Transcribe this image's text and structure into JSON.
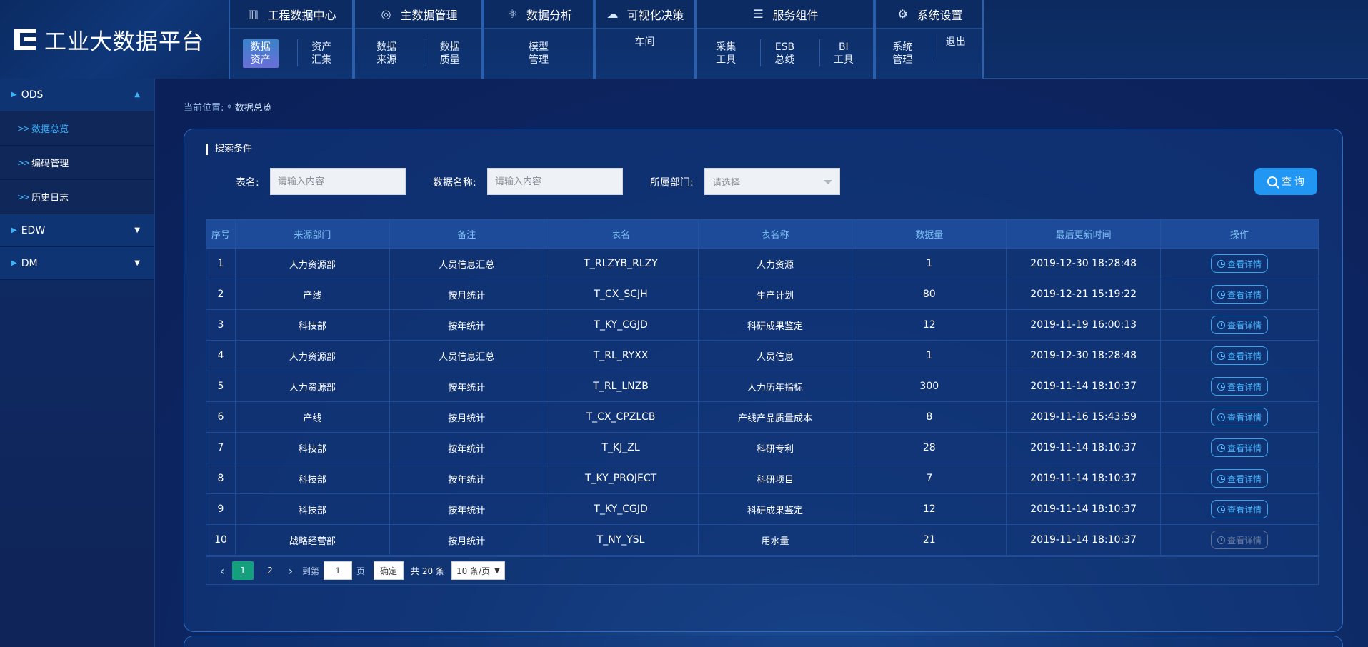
{
  "brand": {
    "title": "工业大数据平台"
  },
  "menu": [
    {
      "title": "工程数据中心",
      "icon": "building-icon",
      "subs": [
        "数据\n资产",
        "资产\n汇集"
      ]
    },
    {
      "title": "主数据管理",
      "icon": "network-icon",
      "subs": [
        "数据\n来源",
        "数据\n质量"
      ]
    },
    {
      "title": "数据分析",
      "icon": "atom-icon",
      "subs": [
        "模型\n管理"
      ]
    },
    {
      "title": "可视化决策",
      "icon": "cloud-icon",
      "subs": [
        "车间"
      ]
    },
    {
      "title": "服务组件",
      "icon": "server-icon",
      "subs": [
        "采集\n工具",
        "ESB\n总线",
        "BI\n工具"
      ]
    },
    {
      "title": "系统设置",
      "icon": "user-gear-icon",
      "subs": [
        "系统\n管理",
        "退出"
      ]
    }
  ],
  "sidebar": {
    "sections": [
      {
        "label": "ODS",
        "expanded": true,
        "items": [
          "数据总览",
          "编码管理",
          "历史日志"
        ]
      },
      {
        "label": "EDW",
        "expanded": false
      },
      {
        "label": "DM",
        "expanded": false
      }
    ]
  },
  "breadcrumb": {
    "prefix": "当前位置:",
    "current": "数据总览"
  },
  "search": {
    "title": "搜索条件",
    "table_label": "表名:",
    "table_placeholder": "请输入内容",
    "name_label": "数据名称:",
    "name_placeholder": "请输入内容",
    "dept_label": "所属部门:",
    "dept_placeholder": "请选择",
    "query_label": "查 询"
  },
  "table": {
    "columns": [
      "序号",
      "来源部门",
      "备注",
      "表名",
      "表名称",
      "数据量",
      "最后更新时间",
      "操作"
    ],
    "action_label": "查看详情",
    "rows": [
      {
        "no": "1",
        "dept": "人力资源部",
        "note": "人员信息汇总",
        "table": "T_RLZYB_RLZY",
        "name": "人力资源",
        "count": "1",
        "time": "2019-12-30 18:28:48",
        "disabled": false
      },
      {
        "no": "2",
        "dept": "产线",
        "note": "按月统计",
        "table": "T_CX_SCJH",
        "name": "生产计划",
        "count": "80",
        "time": "2019-12-21 15:19:22",
        "disabled": false
      },
      {
        "no": "3",
        "dept": "科技部",
        "note": "按年统计",
        "table": "T_KY_CGJD",
        "name": "科研成果鉴定",
        "count": "12",
        "time": "2019-11-19 16:00:13",
        "disabled": false
      },
      {
        "no": "4",
        "dept": "人力资源部",
        "note": "人员信息汇总",
        "table": "T_RL_RYXX",
        "name": "人员信息",
        "count": "1",
        "time": "2019-12-30 18:28:48",
        "disabled": false
      },
      {
        "no": "5",
        "dept": "人力资源部",
        "note": "按年统计",
        "table": "T_RL_LNZB",
        "name": "人力历年指标",
        "count": "300",
        "time": "2019-11-14 18:10:37",
        "disabled": false
      },
      {
        "no": "6",
        "dept": "产线",
        "note": "按月统计",
        "table": "T_CX_CPZLCB",
        "name": "产线产品质量成本",
        "count": "8",
        "time": "2019-11-16 15:43:59",
        "disabled": false
      },
      {
        "no": "7",
        "dept": "科技部",
        "note": "按年统计",
        "table": "T_KJ_ZL",
        "name": "科研专利",
        "count": "28",
        "time": "2019-11-14 18:10:37",
        "disabled": false
      },
      {
        "no": "8",
        "dept": "科技部",
        "note": "按年统计",
        "table": "T_KY_PROJECT",
        "name": "科研项目",
        "count": "7",
        "time": "2019-11-14 18:10:37",
        "disabled": false
      },
      {
        "no": "9",
        "dept": "科技部",
        "note": "按年统计",
        "table": "T_KY_CGJD",
        "name": "科研成果鉴定",
        "count": "12",
        "time": "2019-11-14 18:10:37",
        "disabled": false
      },
      {
        "no": "10",
        "dept": "战略经营部",
        "note": "按月统计",
        "table": "T_NY_YSL",
        "name": "用水量",
        "count": "21",
        "time": "2019-11-14 18:10:37",
        "disabled": true
      }
    ]
  },
  "pager": {
    "pages": [
      "1",
      "2"
    ],
    "current": "1",
    "goto_label": "到第",
    "goto_value": "1",
    "page_label": "页",
    "confirm_label": "确定",
    "total_label": "共 20 条",
    "size_label": "10 条/页"
  }
}
